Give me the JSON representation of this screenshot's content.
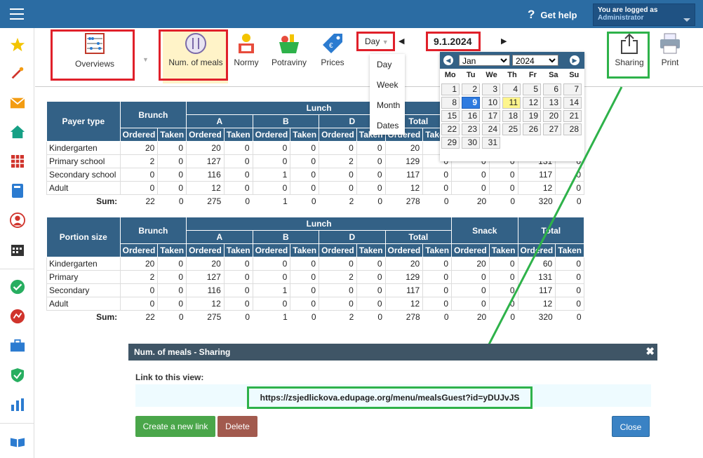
{
  "header": {
    "help_label": "Get help",
    "login_line1": "You are logged as",
    "login_line2": "Administrator"
  },
  "toolbar": {
    "overviews": "Overviews",
    "num_meals": "Num. of meals",
    "normy": "Normy",
    "potraviny": "Potraviny",
    "prices": "Prices",
    "period": "Day",
    "date": "9.1.2024",
    "prev_arrow": "◀",
    "next_arrow": "▶",
    "sharing": "Sharing",
    "print": "Print"
  },
  "period_menu": [
    "Day",
    "Week",
    "Month",
    "Dates"
  ],
  "calendar": {
    "month": "Jan",
    "year": "2024",
    "dow": [
      "Mo",
      "Tu",
      "We",
      "Th",
      "Fr",
      "Sa",
      "Su"
    ],
    "selected_day": 9,
    "today_day": 11
  },
  "table1": {
    "title": "Payer type",
    "brunch": "Brunch",
    "lunch": "Lunch",
    "a": "A",
    "b": "B",
    "d": "D",
    "total": "Total",
    "ordered": "Ordered",
    "taken": "Taken",
    "rows": [
      {
        "label": "Kindergarten",
        "vals": [
          "20",
          "0",
          "20",
          "0",
          "0",
          "0",
          "0",
          "0",
          "20",
          "0"
        ]
      },
      {
        "label": "Primary school",
        "vals": [
          "2",
          "0",
          "127",
          "0",
          "0",
          "0",
          "2",
          "0",
          "129",
          "0"
        ]
      },
      {
        "label": "Secondary school",
        "vals": [
          "0",
          "0",
          "116",
          "0",
          "1",
          "0",
          "0",
          "0",
          "117",
          "0"
        ]
      },
      {
        "label": "Adult",
        "vals": [
          "0",
          "0",
          "12",
          "0",
          "0",
          "0",
          "0",
          "0",
          "12",
          "0"
        ]
      }
    ],
    "right_vals": [
      [
        "",
        "",
        "",
        " ",
        " "
      ],
      [
        "0",
        "0",
        "131",
        "0"
      ],
      [
        "0",
        "0",
        "117",
        "0"
      ],
      [
        "0",
        "0",
        "12",
        "0"
      ]
    ],
    "sum_label": "Sum:",
    "sum": [
      "22",
      "0",
      "275",
      "0",
      "1",
      "0",
      "2",
      "0",
      "278",
      "0",
      "20",
      "0",
      "320",
      "0"
    ]
  },
  "table2": {
    "title": "Portion size",
    "snack": "Snack",
    "total": "Total",
    "rows": [
      {
        "label": "Kindergarten",
        "vals": [
          "20",
          "0",
          "20",
          "0",
          "0",
          "0",
          "0",
          "0",
          "20",
          "0",
          "20",
          "0",
          "60",
          "0"
        ]
      },
      {
        "label": "Primary",
        "vals": [
          "2",
          "0",
          "127",
          "0",
          "0",
          "0",
          "2",
          "0",
          "129",
          "0",
          "0",
          "0",
          "131",
          "0"
        ]
      },
      {
        "label": "Secondary",
        "vals": [
          "0",
          "0",
          "116",
          "0",
          "1",
          "0",
          "0",
          "0",
          "117",
          "0",
          "0",
          "0",
          "117",
          "0"
        ]
      },
      {
        "label": "Adult",
        "vals": [
          "0",
          "0",
          "12",
          "0",
          "0",
          "0",
          "0",
          "0",
          "12",
          "0",
          "0",
          "0",
          "12",
          "0"
        ]
      }
    ],
    "sum_label": "Sum:",
    "sum": [
      "22",
      "0",
      "275",
      "0",
      "1",
      "0",
      "2",
      "0",
      "278",
      "0",
      "20",
      "0",
      "320",
      "0"
    ]
  },
  "dialog": {
    "title": "Num. of meals - Sharing",
    "close_x": "✖",
    "link_label": "Link to this view:",
    "link": "https://zsjedlickova.edupage.org/menu/mealsGuest?id=yDUJvJS",
    "create": "Create a new link",
    "delete": "Delete",
    "close": "Close"
  },
  "colors": {
    "accent": "#2b6ca3",
    "table_header": "#336186",
    "red_box": "#e0202a",
    "green_box": "#2eb24a"
  }
}
